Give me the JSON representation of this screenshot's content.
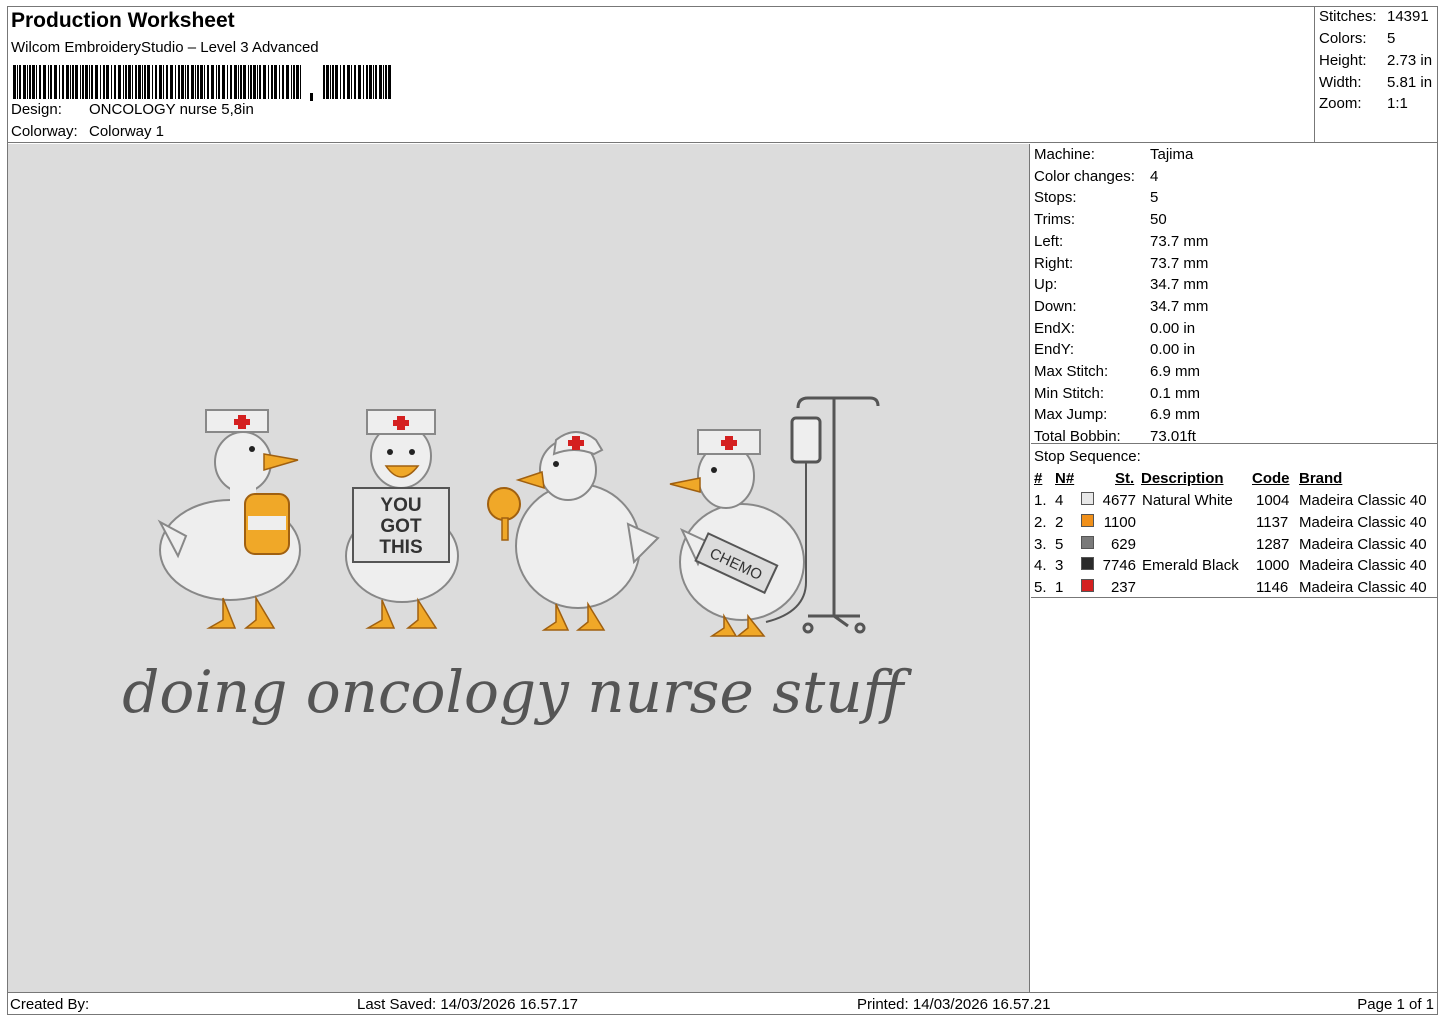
{
  "header": {
    "title": "Production Worksheet",
    "subtitle": "Wilcom EmbroideryStudio – Level 3 Advanced",
    "design_label": "Design:",
    "design_value": "ONCOLOGY nurse 5,8in",
    "colorway_label": "Colorway:",
    "colorway_value": "Colorway 1"
  },
  "stats": [
    {
      "label": "Stitches:",
      "value": "14391"
    },
    {
      "label": "Colors:",
      "value": "5"
    },
    {
      "label": "Height:",
      "value": "2.73 in"
    },
    {
      "label": "Width:",
      "value": "5.81 in"
    },
    {
      "label": "Zoom:",
      "value": "1:1"
    }
  ],
  "machine_info": [
    {
      "label": "Machine:",
      "value": "Tajima"
    },
    {
      "label": "Color changes:",
      "value": "4"
    },
    {
      "label": "Stops:",
      "value": "5"
    },
    {
      "label": "Trims:",
      "value": "50"
    },
    {
      "label": "Left:",
      "value": "73.7 mm"
    },
    {
      "label": "Right:",
      "value": "73.7 mm"
    },
    {
      "label": "Up:",
      "value": "34.7 mm"
    },
    {
      "label": "Down:",
      "value": "34.7 mm"
    },
    {
      "label": "EndX:",
      "value": "0.00 in"
    },
    {
      "label": "EndY:",
      "value": "0.00 in"
    },
    {
      "label": "Max Stitch:",
      "value": "6.9 mm"
    },
    {
      "label": "Min Stitch:",
      "value": "0.1 mm"
    },
    {
      "label": "Max Jump:",
      "value": "6.9 mm"
    },
    {
      "label": "Total Bobbin:",
      "value": "73.01ft"
    }
  ],
  "stop_sequence": {
    "title": "Stop Sequence:",
    "headers": {
      "num": "#",
      "n": "N#",
      "st": "St.",
      "description": "Description",
      "code": "Code",
      "brand": "Brand"
    },
    "rows": [
      {
        "num": "1.",
        "n": "4",
        "color": "#e8e8e8",
        "st": "4677",
        "description": "Natural White",
        "code": "1004",
        "brand": "Madeira Classic 40"
      },
      {
        "num": "2.",
        "n": "2",
        "color": "#f0901a",
        "st": "1100",
        "description": "",
        "code": "1137",
        "brand": "Madeira Classic 40"
      },
      {
        "num": "3.",
        "n": "5",
        "color": "#7a7a7a",
        "st": "629",
        "description": "",
        "code": "1287",
        "brand": "Madeira Classic 40"
      },
      {
        "num": "4.",
        "n": "3",
        "color": "#2a2a2a",
        "st": "7746",
        "description": "Emerald Black",
        "code": "1000",
        "brand": "Madeira Classic 40"
      },
      {
        "num": "5.",
        "n": "1",
        "color": "#d42020",
        "st": "237",
        "description": "",
        "code": "1146",
        "brand": "Madeira Classic 40"
      }
    ]
  },
  "design_preview": {
    "caption": "doing oncology nurse stuff",
    "sign_lines": [
      "YOU",
      "GOT",
      "THIS"
    ],
    "bag_label": "CHEMO"
  },
  "footer": {
    "created_by": "Created By:",
    "last_saved": "Last Saved: 14/03/2026 16.57.17",
    "printed": "Printed: 14/03/2026 16.57.21",
    "page": "Page 1 of 1"
  }
}
